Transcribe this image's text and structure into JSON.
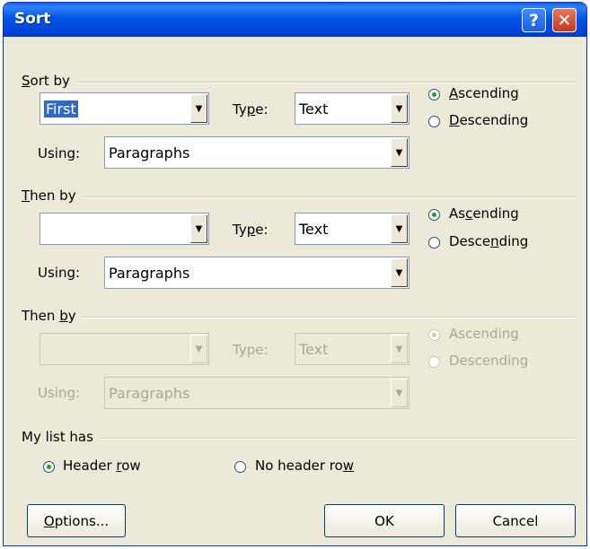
{
  "dialog": {
    "title": "Sort"
  },
  "titlebar": {
    "help_glyph": "?",
    "close_glyph": "✕"
  },
  "group1": {
    "label_pre": "",
    "label_u": "S",
    "label_post": "ort by",
    "field_value": "First",
    "type_label_pre": "Ty",
    "type_label_u": "p",
    "type_label_post": "e:",
    "type_value": "Text",
    "using_label": "Using:",
    "using_value": "Paragraphs",
    "asc_pre": "",
    "asc_u": "A",
    "asc_post": "scending",
    "desc_pre": "",
    "desc_u": "D",
    "desc_post": "escending",
    "sort_order": "Ascending"
  },
  "group2": {
    "label_pre": "",
    "label_u": "T",
    "label_post": "hen by",
    "field_value": "",
    "type_label_pre": "Ty",
    "type_label_u": "p",
    "type_label_post": "e:",
    "type_value": "Text",
    "using_label": "Using:",
    "using_value": "Paragraphs",
    "asc_pre": "As",
    "asc_u": "c",
    "asc_post": "ending",
    "desc_pre": "Desce",
    "desc_u": "n",
    "desc_post": "ding",
    "sort_order": "Ascending"
  },
  "group3": {
    "label_pre": "Then ",
    "label_u": "b",
    "label_post": "y",
    "field_value": "",
    "type_label": "Type:",
    "type_value": "Text",
    "using_label": "Using:",
    "using_value": "Paragraphs",
    "asc_label": "Ascending",
    "desc_label": "Descending",
    "sort_order": "Ascending"
  },
  "list": {
    "label": "My list has",
    "header_pre": "Header ",
    "header_u": "r",
    "header_post": "ow",
    "noheader_pre": "No header ro",
    "noheader_u": "w",
    "noheader_post": "",
    "selected": "Header row"
  },
  "buttons": {
    "options_pre": "",
    "options_u": "O",
    "options_post": "ptions...",
    "ok": "OK",
    "cancel": "Cancel"
  },
  "colors": {
    "title_bar": "#0054e3",
    "face": "#ece9d8",
    "selection": "#316ac5"
  }
}
